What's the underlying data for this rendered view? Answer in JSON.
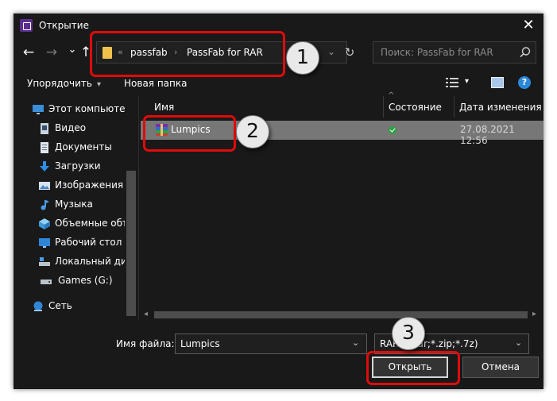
{
  "window": {
    "title": "Открытие",
    "close_glyph": "✕"
  },
  "nav": {
    "back_glyph": "←",
    "forward_glyph": "→",
    "recent_glyph": "⌄",
    "up_glyph": "↑"
  },
  "address": {
    "lead_sep": "«",
    "crumbs": [
      "passfab",
      "PassFab for RAR"
    ],
    "crumb_sep": "›",
    "dropdown_glyph": "⌄",
    "refresh_glyph": "↻"
  },
  "search": {
    "placeholder": "Поиск: PassFab for RAR"
  },
  "toolbar": {
    "organize_label": "Упорядочить",
    "organize_caret": "▾",
    "new_folder_label": "Новая папка",
    "view_caret": "▾",
    "help_glyph": "?"
  },
  "sidebar": {
    "items": [
      {
        "label": "Этот компьютер",
        "icon": "computer-icon"
      },
      {
        "label": "Видео",
        "icon": "video-icon"
      },
      {
        "label": "Документы",
        "icon": "documents-icon"
      },
      {
        "label": "Загрузки",
        "icon": "downloads-icon"
      },
      {
        "label": "Изображения",
        "icon": "images-icon"
      },
      {
        "label": "Музыка",
        "icon": "music-icon"
      },
      {
        "label": "Объемные объ",
        "icon": "3d-objects-icon"
      },
      {
        "label": "Рабочий стол",
        "icon": "desktop-icon"
      },
      {
        "label": "Локальный ди",
        "icon": "local-disk-icon"
      },
      {
        "label": "Games (G:)",
        "icon": "drive-icon"
      },
      {
        "label": "Сеть",
        "icon": "network-icon"
      }
    ]
  },
  "columns": {
    "name": "Имя",
    "status": "Состояние",
    "date": "Дата изменения",
    "sort_glyph": "^"
  },
  "files": [
    {
      "name": "Lumpics",
      "icon": "rar-archive-icon",
      "status": "synced",
      "modified": "27.08.2021 12:56"
    }
  ],
  "scroll": {
    "left_glyph": "◂",
    "right_glyph": "▸"
  },
  "footer": {
    "filename_label": "Имя файла:",
    "filename_value": "Lumpics",
    "filetype_value": "RAR (*.rar;*.zip;*.7z)",
    "dropdown_glyph": "⌄",
    "open_label": "Открыть",
    "cancel_label": "Отмена"
  },
  "annotations": {
    "badges": [
      "1",
      "2",
      "3"
    ],
    "highlight_color": "#e00b0b"
  },
  "colors": {
    "window_bg": "#191919",
    "selected_row": "#777777",
    "accent_blue": "#2b88d8",
    "status_green": "#2ea043",
    "folder_yellow": "#f0c24b"
  }
}
